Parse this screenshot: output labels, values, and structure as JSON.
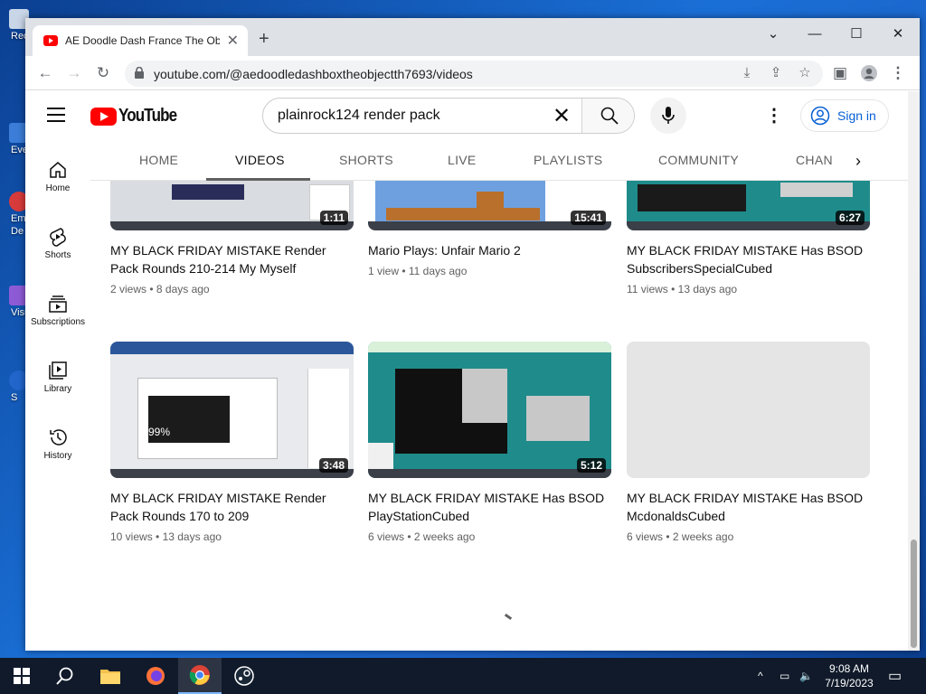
{
  "desktop": {
    "icons": [
      {
        "label": "Rec",
        "color": "#c9d6e8"
      },
      {
        "label": "Eve",
        "color": "#3b7dd8"
      },
      {
        "label": "Emb",
        "color": "#d83b3b"
      },
      {
        "label": "De",
        "color": "#d83b3b"
      },
      {
        "label": "Visu",
        "color": "#8e5bd6"
      },
      {
        "label": "S",
        "color": "#2266cc"
      }
    ]
  },
  "browser": {
    "tab_title": "AE Doodle Dash France The Obje",
    "url": "youtube.com/@aedoodledashboxtheobjectth7693/videos"
  },
  "youtube": {
    "logo_text": "YouTube",
    "search_query": "plainrock124 render pack",
    "signin_label": "Sign in",
    "guide": [
      {
        "label": "Home",
        "icon": "home-icon"
      },
      {
        "label": "Shorts",
        "icon": "shorts-icon"
      },
      {
        "label": "Subscriptions",
        "icon": "subscriptions-icon"
      },
      {
        "label": "Library",
        "icon": "library-icon"
      },
      {
        "label": "History",
        "icon": "history-icon"
      }
    ],
    "channel_tabs": [
      "HOME",
      "VIDEOS",
      "SHORTS",
      "LIVE",
      "PLAYLISTS",
      "COMMUNITY",
      "CHAN"
    ],
    "selected_tab": "VIDEOS",
    "videos": [
      {
        "title": "MY BLACK FRIDAY MISTAKE Render Pack Rounds 210-214 My Myself",
        "views": "2 views",
        "age": "8 days ago",
        "duration": "1:11",
        "thumb": "#d9dce0"
      },
      {
        "title": "Mario Plays: Unfair Mario 2",
        "views": "1 view",
        "age": "11 days ago",
        "duration": "15:41",
        "thumb": "#6ea0e0"
      },
      {
        "title": "MY BLACK FRIDAY MISTAKE Has BSOD SubscribersSpecialCubed",
        "views": "11 views",
        "age": "13 days ago",
        "duration": "6:27",
        "thumb": "#1f8b8b"
      },
      {
        "title": "MY BLACK FRIDAY MISTAKE Render Pack Rounds 170 to 209",
        "views": "10 views",
        "age": "13 days ago",
        "duration": "3:48",
        "thumb": "#e8eaed",
        "overlay_text": "99%"
      },
      {
        "title": "MY BLACK FRIDAY MISTAKE Has BSOD PlayStationCubed",
        "views": "6 views",
        "age": "2 weeks ago",
        "duration": "5:12",
        "thumb": "#1f8b8b"
      },
      {
        "title": "MY BLACK FRIDAY MISTAKE Has BSOD McdonaldsCubed",
        "views": "6 views",
        "age": "2 weeks ago",
        "duration": "",
        "thumb": "#e5e5e5"
      }
    ]
  },
  "taskbar": {
    "time": "9:08 AM",
    "date": "7/19/2023"
  }
}
